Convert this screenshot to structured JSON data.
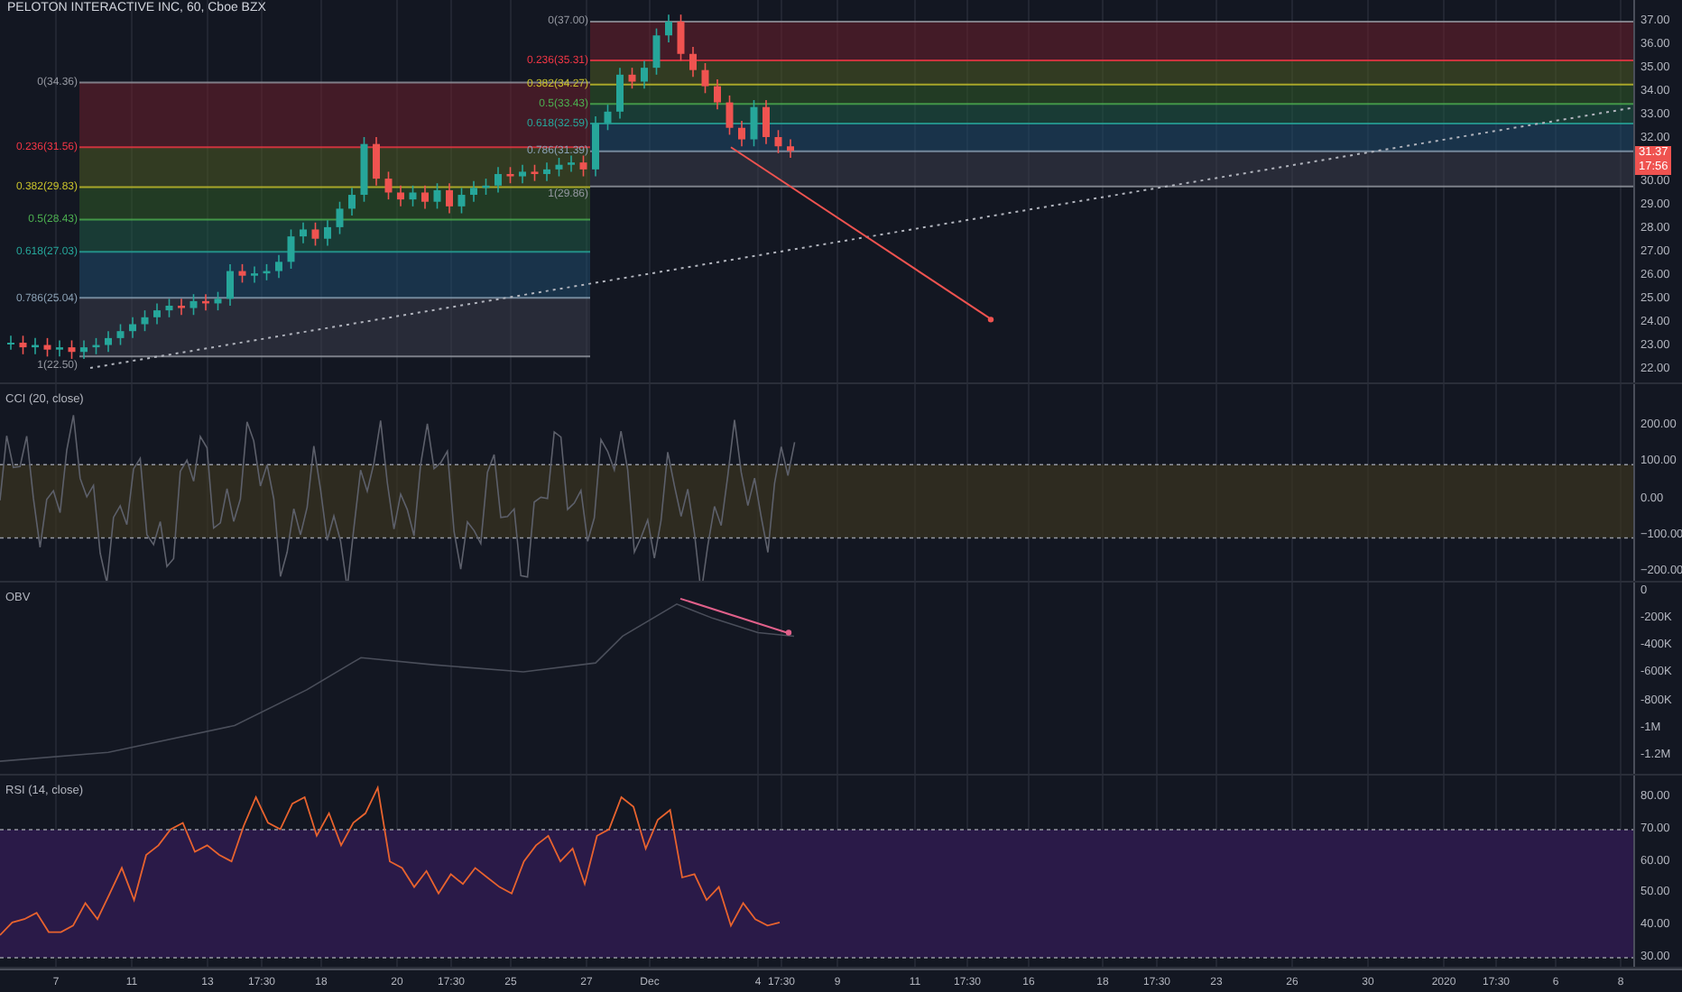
{
  "title": "PELOTON INTERACTIVE INC, 60, Cboe BZX",
  "main_pane": {
    "price_axis": [
      {
        "kind": "tick",
        "label": "37.00"
      },
      {
        "kind": "tick",
        "label": "36.00"
      },
      {
        "kind": "tick",
        "label": "35.00"
      },
      {
        "kind": "tick",
        "label": "34.00"
      },
      {
        "kind": "tick",
        "label": "33.00"
      },
      {
        "kind": "tick",
        "label": "32.00"
      },
      {
        "kind": "price_tags",
        "last_price": "31.37",
        "countdown": "17:56"
      },
      {
        "kind": "tick",
        "label": "30.00"
      },
      {
        "kind": "tick",
        "label": "29.00"
      },
      {
        "kind": "tick",
        "label": "28.00"
      },
      {
        "kind": "tick",
        "label": "27.00"
      },
      {
        "kind": "tick",
        "label": "26.00"
      },
      {
        "kind": "tick",
        "label": "25.00"
      },
      {
        "kind": "tick",
        "label": "24.00"
      },
      {
        "kind": "tick",
        "label": "23.00"
      },
      {
        "kind": "tick",
        "label": "22.00"
      }
    ],
    "fib_left": [
      "0(34.36)",
      "0.236(31.56)",
      "0.382(29.83)",
      "0.5(28.43)",
      "0.618(27.03)",
      "0.786(25.04)",
      "1(22.50)"
    ],
    "fib_right": [
      "0(37.00)",
      "0.236(35.31)",
      "0.382(34.27)",
      "0.5(33.43)",
      "0.618(32.59)",
      "0.786(31.39)",
      "1(29.86)"
    ]
  },
  "cci_pane": {
    "title": "CCI (20, close)",
    "axis": [
      "200.00",
      "100.00",
      "0.00",
      "−100.00",
      "−200.00"
    ]
  },
  "obv_pane": {
    "title": "OBV",
    "axis": [
      "0",
      "-200K",
      "-400K",
      "-600K",
      "-800K",
      "-1M",
      "-1.2M"
    ]
  },
  "rsi_pane": {
    "title": "RSI (14, close)",
    "axis": [
      "80.00",
      "70.00",
      "60.00",
      "50.00",
      "40.00",
      "30.00"
    ]
  },
  "time_axis": [
    "7",
    "11",
    "13",
    "17:30",
    "18",
    "20",
    "17:30",
    "25",
    "27",
    "Dec",
    "4",
    "17:30",
    "9",
    "11",
    "17:30",
    "16",
    "18",
    "17:30",
    "23",
    "26",
    "30",
    "2020",
    "17:30",
    "6",
    "8"
  ]
}
